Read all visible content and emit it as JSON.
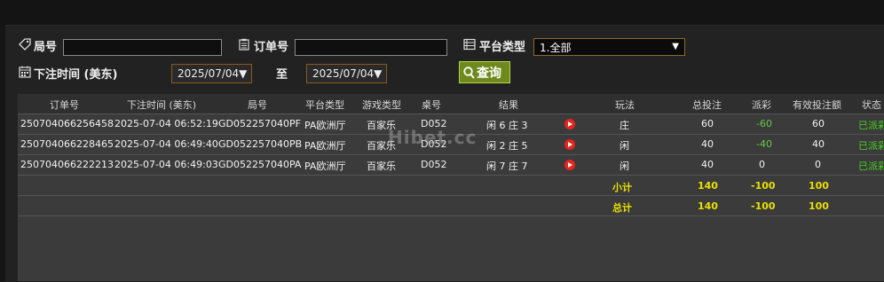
{
  "filters": {
    "round_label": "局号",
    "order_label": "订单号",
    "platform_label": "平台类型",
    "platform_selected": "1.全部",
    "bet_time_label": "下注时间 (美东)",
    "date_from": "2025/07/04▼",
    "to_label": "至",
    "date_to": "2025/07/04▼",
    "query_label": "查询"
  },
  "table": {
    "headers": [
      "订单号",
      "下注时间 (美东)",
      "局号",
      "平台类型",
      "游戏类型",
      "桌号",
      "结果",
      "玩法",
      "总投注",
      "派彩",
      "有效投注额",
      "状态"
    ],
    "rows": [
      {
        "order": "250704066256458",
        "time": "2025-07-04 06:52:19",
        "round": "GD052257040PF",
        "platform": "PA欧洲厅",
        "game": "百家乐",
        "table": "D052",
        "result": "闲 6 庄 3",
        "play": "庄",
        "bet": "60",
        "payout": "-60",
        "valid": "60",
        "status": "已派彩"
      },
      {
        "order": "250704066228465",
        "time": "2025-07-04 06:49:40",
        "round": "GD052257040PB",
        "platform": "PA欧洲厅",
        "game": "百家乐",
        "table": "D052",
        "result": "闲 2 庄 5",
        "play": "闲",
        "bet": "40",
        "payout": "-40",
        "valid": "40",
        "status": "已派彩"
      },
      {
        "order": "250704066222213",
        "time": "2025-07-04 06:49:03",
        "round": "GD052257040PA",
        "platform": "PA欧洲厅",
        "game": "百家乐",
        "table": "D052",
        "result": "闲 7 庄 7",
        "play": "闲",
        "bet": "40",
        "payout": "0",
        "valid": "0",
        "status": "已派彩"
      }
    ],
    "subtotal": {
      "label": "小计",
      "bet": "140",
      "payout": "-100",
      "valid": "100"
    },
    "total": {
      "label": "总计",
      "bet": "140",
      "payout": "-100",
      "valid": "100"
    }
  },
  "watermark": "Hibet.cc",
  "colors": {
    "accent_green": "#6e8a1e",
    "total_yellow": "#e8e000",
    "status_green": "#46d11f",
    "play_red": "#e8241d"
  }
}
